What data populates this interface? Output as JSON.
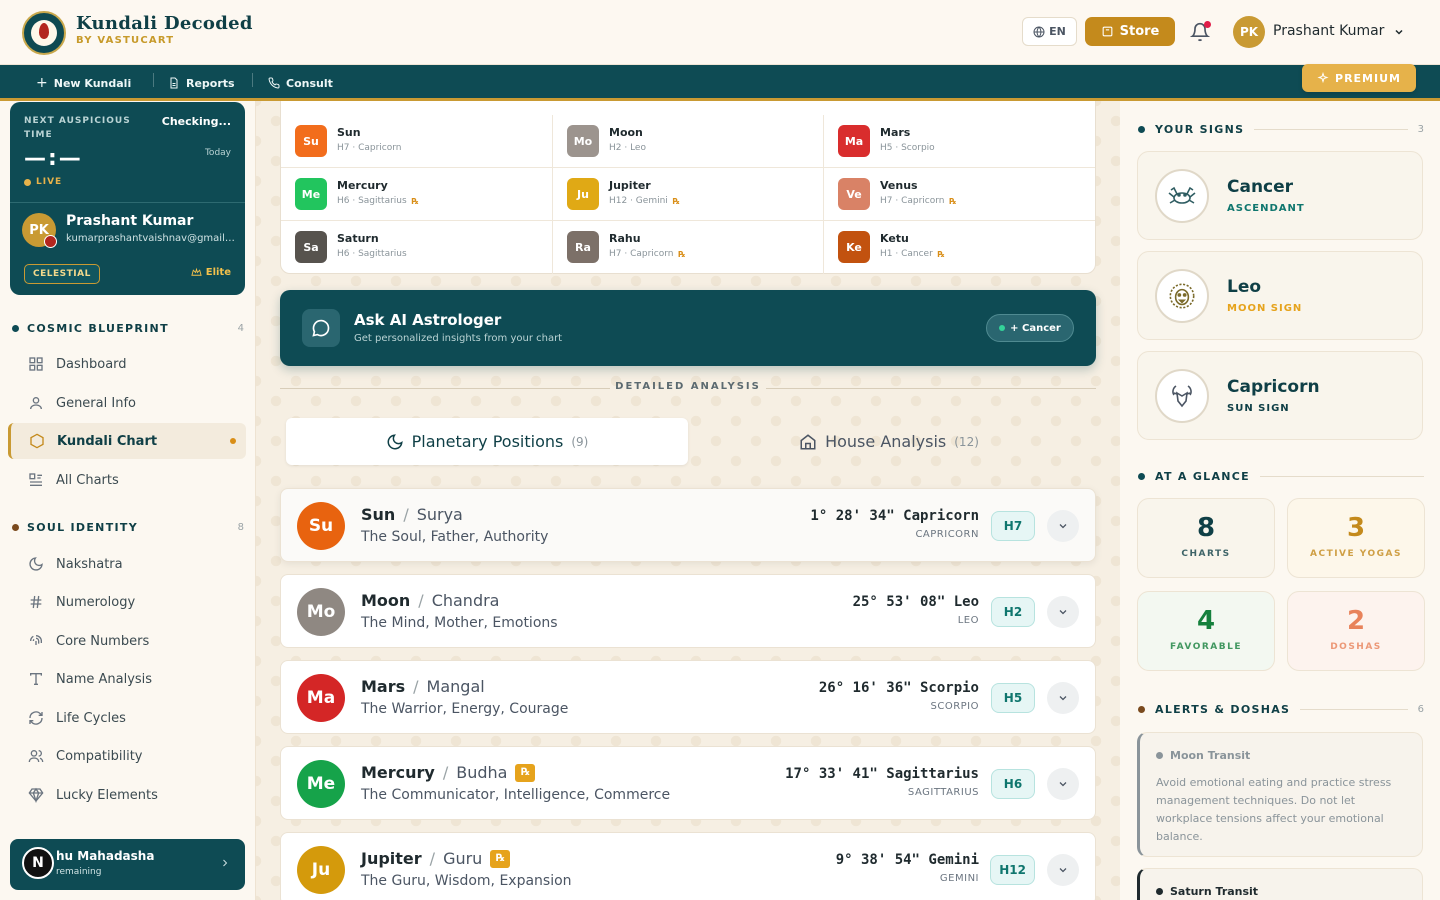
{
  "header": {
    "brand_title": "Kundali Decoded",
    "brand_sub": "BY VASTUCART",
    "lang": "EN",
    "store": "Store",
    "user_initials": "PK",
    "user_name": "Prashant Kumar"
  },
  "nav": {
    "new_kundali": "New Kundali",
    "reports": "Reports",
    "consult": "Consult",
    "premium": "PREMIUM"
  },
  "sidebar": {
    "auspicious_label": "NEXT AUSPICIOUS TIME",
    "auspicious_status": "Checking...",
    "auspicious_time": "—:—",
    "auspicious_day": "Today",
    "live": "LIVE",
    "profile_initials": "PK",
    "profile_name": "Prashant Kumar",
    "profile_email": "kumarprashantvaishnav@gmail.com",
    "tier": "CELESTIAL",
    "elite": "Elite",
    "section1": {
      "title": "COSMIC BLUEPRINT",
      "count": "4",
      "items": [
        {
          "label": "Dashboard",
          "icon": "grid-icon"
        },
        {
          "label": "General Info",
          "icon": "user-icon"
        },
        {
          "label": "Kundali Chart",
          "icon": "hexagon-icon"
        },
        {
          "label": "All Charts",
          "icon": "list-icon"
        }
      ]
    },
    "section2": {
      "title": "SOUL IDENTITY",
      "count": "8",
      "items": [
        {
          "label": "Nakshatra",
          "icon": "moon-icon"
        },
        {
          "label": "Numerology",
          "icon": "hash-icon"
        },
        {
          "label": "Core Numbers",
          "icon": "fingerprint-icon"
        },
        {
          "label": "Name Analysis",
          "icon": "type-icon"
        },
        {
          "label": "Life Cycles",
          "icon": "refresh-icon"
        },
        {
          "label": "Compatibility",
          "icon": "users-icon"
        },
        {
          "label": "Lucky Elements",
          "icon": "gem-icon"
        }
      ]
    },
    "dasha_title": "hu Mahadasha",
    "dasha_sub": "remaining"
  },
  "planet_grid": [
    {
      "abbr": "Su",
      "name": "Sun",
      "sub": "H7 · Capricorn",
      "rx": false,
      "color": "#f26d1c"
    },
    {
      "abbr": "Mo",
      "name": "Moon",
      "sub": "H2 · Leo",
      "rx": false,
      "color": "#9c948e"
    },
    {
      "abbr": "Ma",
      "name": "Mars",
      "sub": "H5 · Scorpio",
      "rx": false,
      "color": "#d92d2d"
    },
    {
      "abbr": "Me",
      "name": "Mercury",
      "sub": "H6 · Sagittarius",
      "rx": true,
      "color": "#22c55e"
    },
    {
      "abbr": "Ju",
      "name": "Jupiter",
      "sub": "H12 · Gemini",
      "rx": true,
      "color": "#e0a915"
    },
    {
      "abbr": "Ve",
      "name": "Venus",
      "sub": "H7 · Capricorn",
      "rx": true,
      "color": "#d98266"
    },
    {
      "abbr": "Sa",
      "name": "Saturn",
      "sub": "H6 · Sagittarius",
      "rx": false,
      "color": "#57534e"
    },
    {
      "abbr": "Ra",
      "name": "Rahu",
      "sub": "H7 · Capricorn",
      "rx": true,
      "color": "#7c7068"
    },
    {
      "abbr": "Ke",
      "name": "Ketu",
      "sub": "H1 · Cancer",
      "rx": true,
      "color": "#c2520f"
    }
  ],
  "ask": {
    "title": "Ask AI Astrologer",
    "sub": "Get personalized insights from your chart",
    "pill": "+ Cancer"
  },
  "detail_heading": "DETAILED ANALYSIS",
  "tabs": [
    {
      "label": "Planetary Positions",
      "count": "(9)"
    },
    {
      "label": "House Analysis",
      "count": "(12)"
    }
  ],
  "planets": [
    {
      "abbr": "Su",
      "name": "Sun",
      "alt": "Surya",
      "desc": "The Soul, Father, Authority",
      "deg": "1° 28' 34\" Capricorn",
      "sign": "CAPRICORN",
      "house": "H7",
      "rx": false,
      "color": "#e8630f"
    },
    {
      "abbr": "Mo",
      "name": "Moon",
      "alt": "Chandra",
      "desc": "The Mind, Mother, Emotions",
      "deg": "25° 53' 08\" Leo",
      "sign": "LEO",
      "house": "H2",
      "rx": false,
      "color": "#8f8882"
    },
    {
      "abbr": "Ma",
      "name": "Mars",
      "alt": "Mangal",
      "desc": "The Warrior, Energy, Courage",
      "deg": "26° 16' 36\" Scorpio",
      "sign": "SCORPIO",
      "house": "H5",
      "rx": false,
      "color": "#d42626"
    },
    {
      "abbr": "Me",
      "name": "Mercury",
      "alt": "Budha",
      "desc": "The Communicator, Intelligence, Commerce",
      "deg": "17° 33' 41\" Sagittarius",
      "sign": "SAGITTARIUS",
      "house": "H6",
      "rx": true,
      "color": "#16a34a"
    },
    {
      "abbr": "Ju",
      "name": "Jupiter",
      "alt": "Guru",
      "desc": "The Guru, Wisdom, Expansion",
      "deg": "9° 38' 54\" Gemini",
      "sign": "GEMINI",
      "house": "H12",
      "rx": true,
      "color": "#d49a0c"
    }
  ],
  "signs_section": {
    "title": "YOUR SIGNS",
    "count": "3"
  },
  "signs": [
    {
      "name": "Cancer",
      "role": "ASCENDANT",
      "role_color": "#0f766e",
      "icon": "crab-icon"
    },
    {
      "name": "Leo",
      "role": "MOON SIGN",
      "role_color": "#e6a31c",
      "icon": "lion-icon"
    },
    {
      "name": "Capricorn",
      "role": "SUN SIGN",
      "role_color": "#0f3f46",
      "icon": "goat-icon"
    }
  ],
  "glance_section": {
    "title": "AT A GLANCE"
  },
  "glance": [
    {
      "value": "8",
      "label": "CHARTS",
      "color": "#0f3f46"
    },
    {
      "value": "3",
      "label": "ACTIVE YOGAS",
      "color": "#c48a1c"
    },
    {
      "value": "4",
      "label": "FAVORABLE",
      "color": "#15803d"
    },
    {
      "value": "2",
      "label": "DOSHAS",
      "color": "#e8825a"
    }
  ],
  "alerts_section": {
    "title": "ALERTS & DOSHAS",
    "count": "6"
  },
  "alerts": [
    {
      "title": "Moon Transit",
      "body": "Avoid emotional eating and practice stress management techniques. Do not let workplace tensions affect your emotional balance."
    },
    {
      "title": "Saturn Transit",
      "body": ""
    }
  ]
}
